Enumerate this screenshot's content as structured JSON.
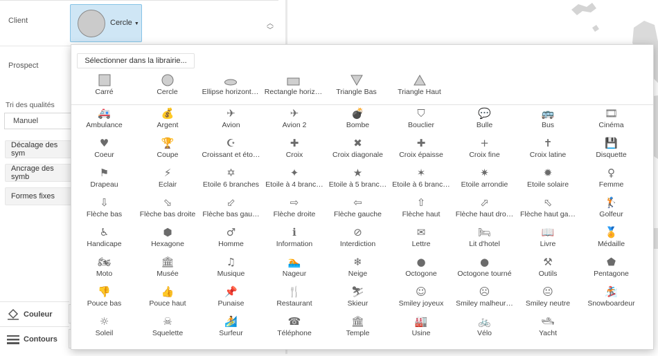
{
  "left": {
    "client_label": "Client",
    "prospect_label": "Prospect",
    "shape_button_label": "Cercle",
    "quality_label": "Tri des qualités",
    "quality_value": "Manuel",
    "decalage_label": "Décalage des sym",
    "ancrage_label": "Ancrage des symb",
    "formes_label": "Formes fixes",
    "couleur_label": "Couleur",
    "contours_label": "Contours"
  },
  "popup": {
    "library_button": "Sélectionner dans la librairie...",
    "basic_shapes": [
      "Carré",
      "Cercle",
      "Ellipse horizont…",
      "Rectangle horiz…",
      "Triangle Bas",
      "Triangle Haut"
    ],
    "symbols": [
      [
        "Ambulance",
        "Argent",
        "Avion",
        "Avion 2",
        "Bombe",
        "Bouclier",
        "Bulle",
        "Bus",
        "Cinéma"
      ],
      [
        "Coeur",
        "Coupe",
        "Croissant et éto…",
        "Croix",
        "Croix diagonale",
        "Croix épaisse",
        "Croix fine",
        "Croix latine",
        "Disquette"
      ],
      [
        "Drapeau",
        "Eclair",
        "Etoile 6 branches",
        "Etoile à 4 branc…",
        "Etoile à 5 branc…",
        "Etoile à 6 branc…",
        "Etoile arrondie",
        "Etoile solaire",
        "Femme"
      ],
      [
        "Flèche bas",
        "Flèche bas droite",
        "Flèche bas gau…",
        "Flèche droite",
        "Flèche gauche",
        "Flèche haut",
        "Flèche haut dro…",
        "Flèche haut ga…",
        "Golfeur"
      ],
      [
        "Handicape",
        "Hexagone",
        "Homme",
        "Information",
        "Interdiction",
        "Lettre",
        "Lit d'hotel",
        "Livre",
        "Médaille"
      ],
      [
        "Moto",
        "Musée",
        "Musique",
        "Nageur",
        "Neige",
        "Octogone",
        "Octogone tourné",
        "Outils",
        "Pentagone"
      ],
      [
        "Pouce bas",
        "Pouce haut",
        "Punaise",
        "Restaurant",
        "Skieur",
        "Smiley joyeux",
        "Smiley malheur…",
        "Smiley neutre",
        "Snowboardeur"
      ],
      [
        "Soleil",
        "Squelette",
        "Surfeur",
        "Téléphone",
        "Temple",
        "Usine",
        "Vélo",
        "Yacht"
      ]
    ],
    "icons": [
      [
        "ambulance-icon",
        "money-bag-icon",
        "plane-icon",
        "plane-2-icon",
        "bomb-icon",
        "shield-icon",
        "speech-bubble-icon",
        "bus-icon",
        "cinema-icon"
      ],
      [
        "heart-icon",
        "trophy-icon",
        "crescent-star-icon",
        "cross-icon",
        "diagonal-cross-icon",
        "thick-cross-icon",
        "thin-cross-icon",
        "latin-cross-icon",
        "floppy-disk-icon"
      ],
      [
        "flag-icon",
        "lightning-icon",
        "star-of-david-icon",
        "four-point-star-icon",
        "five-point-star-icon",
        "six-point-star-icon",
        "rounded-star-icon",
        "sun-star-icon",
        "woman-icon"
      ],
      [
        "arrow-down-icon",
        "arrow-down-right-icon",
        "arrow-down-left-icon",
        "arrow-right-icon",
        "arrow-left-icon",
        "arrow-up-icon",
        "arrow-up-right-icon",
        "arrow-up-left-icon",
        "golfer-icon"
      ],
      [
        "wheelchair-icon",
        "hexagon-icon",
        "man-icon",
        "information-icon",
        "no-entry-icon",
        "letter-icon",
        "hotel-bed-icon",
        "book-icon",
        "medal-icon"
      ],
      [
        "motorcycle-icon",
        "museum-icon",
        "music-icon",
        "swimmer-icon",
        "snowflake-icon",
        "octagon-icon",
        "rotated-octagon-icon",
        "tools-icon",
        "pentagon-icon"
      ],
      [
        "thumbs-down-icon",
        "thumbs-up-icon",
        "pushpin-icon",
        "restaurant-icon",
        "skier-icon",
        "happy-smiley-icon",
        "sad-smiley-icon",
        "neutral-smiley-icon",
        "snowboarder-icon"
      ],
      [
        "sun-icon",
        "skull-icon",
        "surfer-icon",
        "telephone-icon",
        "temple-icon",
        "factory-icon",
        "bicycle-icon",
        "yacht-icon"
      ]
    ],
    "glyphs": [
      [
        "🚑",
        "💰",
        "✈",
        "✈",
        "💣",
        "⛉",
        "💬",
        "🚌",
        "🎞"
      ],
      [
        "♥",
        "🏆",
        "☪",
        "✚",
        "✖",
        "✚",
        "+",
        "✝",
        "💾"
      ],
      [
        "⚑",
        "⚡",
        "✡",
        "✦",
        "★",
        "✶",
        "✷",
        "✹",
        "♀"
      ],
      [
        "⇩",
        "⬂",
        "⬃",
        "⇨",
        "⇦",
        "⇧",
        "⬀",
        "⬁",
        "🏌"
      ],
      [
        "♿",
        "⬢",
        "♂",
        "ℹ",
        "⊘",
        "✉",
        "🛏",
        "📖",
        "🏅"
      ],
      [
        "🏍",
        "🏛",
        "♫",
        "🏊",
        "❄",
        "●",
        "●",
        "⚒",
        "⬟"
      ],
      [
        "👎",
        "👍",
        "📌",
        "🍴",
        "⛷",
        "☺",
        "☹",
        "😐",
        "🏂"
      ],
      [
        "☼",
        "☠",
        "🏄",
        "☎",
        "🏛",
        "🏭",
        "🚲",
        "🛥"
      ]
    ]
  },
  "colors": {
    "accent_border": "#86c3e6",
    "accent_fill": "#cfe6f5",
    "icon_gray": "#6b6b6b"
  }
}
